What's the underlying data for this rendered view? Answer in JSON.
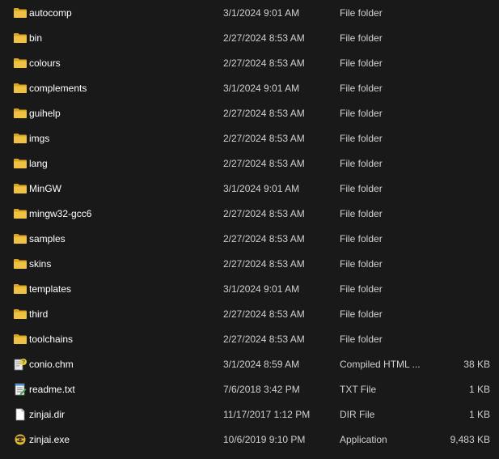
{
  "files": [
    {
      "name": "autocomp",
      "date": "3/1/2024 9:01 AM",
      "type": "File folder",
      "size": "",
      "icon": "folder-icon"
    },
    {
      "name": "bin",
      "date": "2/27/2024 8:53 AM",
      "type": "File folder",
      "size": "",
      "icon": "folder-icon"
    },
    {
      "name": "colours",
      "date": "2/27/2024 8:53 AM",
      "type": "File folder",
      "size": "",
      "icon": "folder-icon"
    },
    {
      "name": "complements",
      "date": "3/1/2024 9:01 AM",
      "type": "File folder",
      "size": "",
      "icon": "folder-icon"
    },
    {
      "name": "guihelp",
      "date": "2/27/2024 8:53 AM",
      "type": "File folder",
      "size": "",
      "icon": "folder-icon"
    },
    {
      "name": "imgs",
      "date": "2/27/2024 8:53 AM",
      "type": "File folder",
      "size": "",
      "icon": "folder-icon"
    },
    {
      "name": "lang",
      "date": "2/27/2024 8:53 AM",
      "type": "File folder",
      "size": "",
      "icon": "folder-icon"
    },
    {
      "name": "MinGW",
      "date": "3/1/2024 9:01 AM",
      "type": "File folder",
      "size": "",
      "icon": "folder-icon"
    },
    {
      "name": "mingw32-gcc6",
      "date": "2/27/2024 8:53 AM",
      "type": "File folder",
      "size": "",
      "icon": "folder-icon"
    },
    {
      "name": "samples",
      "date": "2/27/2024 8:53 AM",
      "type": "File folder",
      "size": "",
      "icon": "folder-icon"
    },
    {
      "name": "skins",
      "date": "2/27/2024 8:53 AM",
      "type": "File folder",
      "size": "",
      "icon": "folder-icon"
    },
    {
      "name": "templates",
      "date": "3/1/2024 9:01 AM",
      "type": "File folder",
      "size": "",
      "icon": "folder-icon"
    },
    {
      "name": "third",
      "date": "2/27/2024 8:53 AM",
      "type": "File folder",
      "size": "",
      "icon": "folder-icon"
    },
    {
      "name": "toolchains",
      "date": "2/27/2024 8:53 AM",
      "type": "File folder",
      "size": "",
      "icon": "folder-icon"
    },
    {
      "name": "conio.chm",
      "date": "3/1/2024 8:59 AM",
      "type": "Compiled HTML ...",
      "size": "38 KB",
      "icon": "chm-help-icon"
    },
    {
      "name": "readme.txt",
      "date": "7/6/2018 3:42 PM",
      "type": "TXT File",
      "size": "1 KB",
      "icon": "text-file-icon"
    },
    {
      "name": "zinjai.dir",
      "date": "11/17/2017 1:12 PM",
      "type": "DIR File",
      "size": "1 KB",
      "icon": "blank-file-icon"
    },
    {
      "name": "zinjai.exe",
      "date": "10/6/2019 9:10 PM",
      "type": "Application",
      "size": "9,483 KB",
      "icon": "zinjai-app-icon"
    }
  ],
  "colors": {
    "background": "#191919",
    "folder": "#f0c244",
    "folder_back": "#d9a520"
  }
}
